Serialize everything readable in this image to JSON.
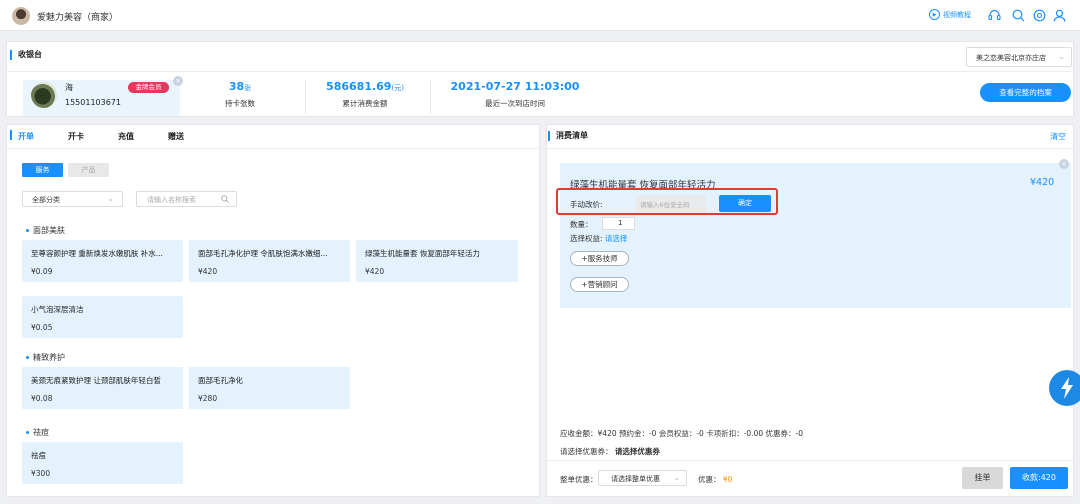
{
  "app": {
    "title": "爱魅力美容（商家）"
  },
  "topbar": {
    "video_tutorial": "视频教程"
  },
  "cashier": {
    "title": "收银台",
    "store": "美之恋美容北京亦庄店",
    "member": {
      "name": "海",
      "phone": "15501103671",
      "badge": "金牌会员"
    },
    "stats": {
      "cards_value": "38",
      "cards_unit": "张",
      "cards_label": "持卡张数",
      "spend_value": "586681.69",
      "spend_unit": "(元)",
      "spend_label": "累计消费金额",
      "last_visit": "2021-07-27 11:03:00",
      "last_visit_label": "最近一次到店时间"
    },
    "profile_button": "查看完整的档案"
  },
  "left": {
    "tabs": [
      "开单",
      "开卡",
      "充值",
      "赠送"
    ],
    "segments": [
      "服务",
      "产品"
    ],
    "category_select": "全部分类",
    "search_placeholder": "请输入名称搜索",
    "categories": [
      {
        "title": "面部美肤",
        "items": [
          {
            "name": "至尊容颜护理 重新焕发水嫩肌肤 补水...",
            "price": "¥0.09"
          },
          {
            "name": "面部毛孔净化护理 令肌肤饱满水嫩细...",
            "price": "¥420"
          },
          {
            "name": "绿藻生机能量套 恢复面部年轻活力",
            "price": "¥420"
          },
          {
            "name": "小气泡深层清洁",
            "price": "¥0.05"
          }
        ]
      },
      {
        "title": "精致养护",
        "items": [
          {
            "name": "美颈无痕紧致护理 让颈部肌肤年轻白皙",
            "price": "¥0.08"
          },
          {
            "name": "面部毛孔净化",
            "price": "¥280"
          }
        ]
      },
      {
        "title": "祛痘",
        "items": [
          {
            "name": "祛痘",
            "price": "¥300"
          }
        ]
      }
    ]
  },
  "right": {
    "title": "消费清单",
    "clear": "清空",
    "order": {
      "name": "绿藻生机能量套 恢复面部年轻活力",
      "price": "¥420",
      "manual_label": "手动改价:",
      "manual_placeholder": "请输入6位安全码",
      "confirm": "确定",
      "qty_label": "数量：",
      "qty": "1",
      "benefit_label": "选择权益:",
      "benefit_link": "请选择",
      "add_tech": "+服务技师",
      "add_consultant": "+营销顾问"
    },
    "summary": "应收金额：¥420   预约金：-0   会员权益：-0   卡项折扣：-0.00  优惠券：-0",
    "coupon_label": "请选择优惠券：",
    "coupon_link": "请选择优惠券",
    "footer": {
      "discount_label": "整单优惠：",
      "discount_select": "请选择整单优惠",
      "discount_amount_label": "优惠：",
      "discount_amount": "¥0",
      "hang": "挂单",
      "pay": "收款:420"
    }
  },
  "colors": {
    "accent": "#1890ff",
    "badge": "#e8365d",
    "highlight": "#e53935",
    "card_bg": "#e3f2fd"
  }
}
